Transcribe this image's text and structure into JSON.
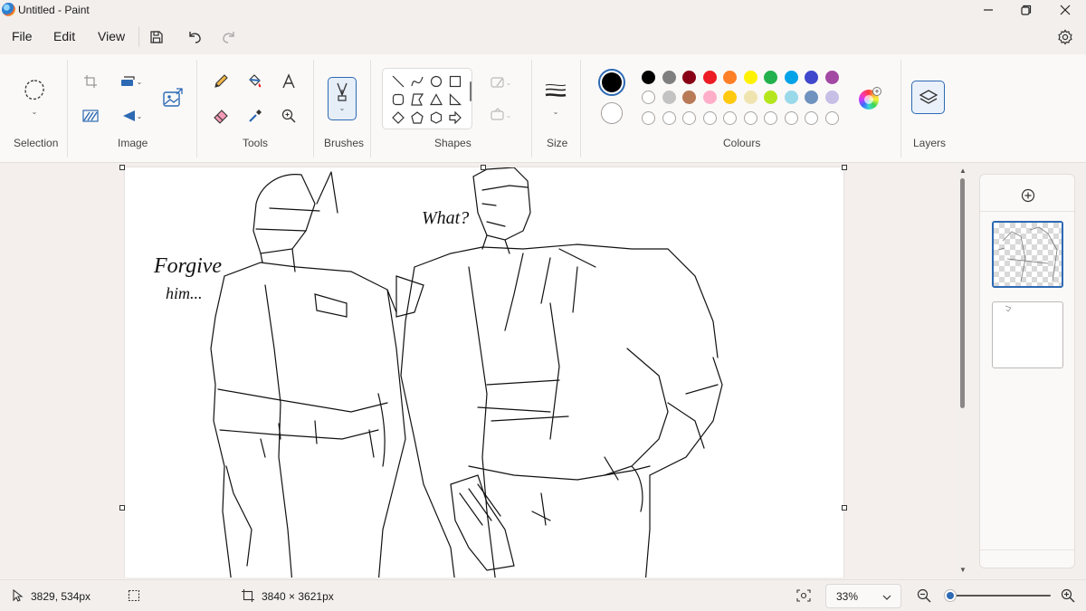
{
  "window": {
    "title": "Untitled - Paint",
    "minimize_icon": "minimize-icon",
    "maximize_icon": "restore-icon",
    "close_icon": "close-icon"
  },
  "menu": {
    "file": "File",
    "edit": "Edit",
    "view": "View",
    "icons": [
      "save-icon",
      "undo-icon",
      "redo-icon",
      "settings-icon"
    ]
  },
  "ribbon": {
    "groups": {
      "selection": "Selection",
      "image": "Image",
      "tools": "Tools",
      "brushes": "Brushes",
      "shapes": "Shapes",
      "size": "Size",
      "colours": "Colours",
      "layers": "Layers"
    },
    "image_tools": [
      "crop-icon",
      "resize-icon",
      "remove-background-icon",
      "rotate-icon",
      "image-generate-icon"
    ],
    "tools": [
      "pencil-icon",
      "fill-icon",
      "text-icon",
      "eraser-icon",
      "color-picker-icon",
      "magnifier-icon"
    ],
    "shapes": [
      "line",
      "curve",
      "oval",
      "rectangle",
      "rounded-rectangle",
      "polygon",
      "triangle",
      "right-triangle",
      "diamond",
      "pentagon",
      "hexagon",
      "arrow"
    ],
    "colours": {
      "primary": "#000000",
      "secondary": "#ffffff",
      "palette": [
        "#000000",
        "#7f7f7f",
        "#880015",
        "#ed1c24",
        "#ff7f27",
        "#fff200",
        "#22b14c",
        "#00a2e8",
        "#3f48cc",
        "#a349a4",
        "#ffffff",
        "#c3c3c3",
        "#b97a57",
        "#ffaec9",
        "#ffc90e",
        "#efe4b0",
        "#b5e61d",
        "#99d9ea",
        "#7092be",
        "#c8bfe7"
      ],
      "custom_slots": 10
    }
  },
  "canvas": {
    "annotations": [
      "Forgive him...",
      "What?"
    ]
  },
  "status": {
    "cursor_position": "3829, 534px",
    "canvas_size": "3840 × 3621px",
    "zoom": "33%",
    "zoom_fraction": 0.0
  }
}
